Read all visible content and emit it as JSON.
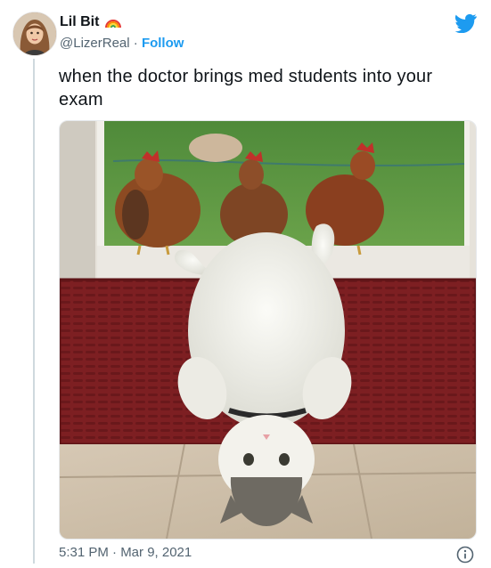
{
  "author": {
    "display_name": "Lil Bit",
    "handle": "@LizerReal",
    "separator": "·",
    "follow_label": "Follow"
  },
  "tweet": {
    "text": "when the doctor brings med students into your exam",
    "timestamp": "5:31 PM · Mar 9, 2021"
  },
  "icons": {
    "rainbow": "rainbow-icon",
    "brand": "twitter-bird-icon",
    "info": "info-icon"
  },
  "colors": {
    "accent": "#1d9bf0",
    "secondary_text": "#536471",
    "primary_text": "#0f1419"
  }
}
